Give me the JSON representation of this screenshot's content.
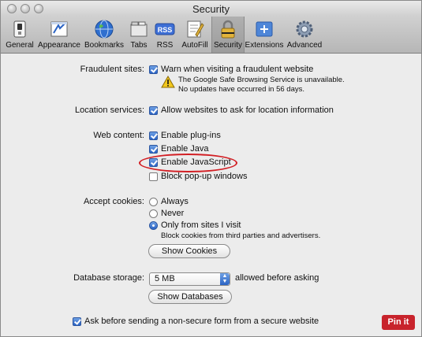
{
  "window": {
    "title": "Security"
  },
  "toolbar": {
    "items": [
      {
        "label": "General",
        "icon": "general-switch-icon"
      },
      {
        "label": "Appearance",
        "icon": "appearance-icon"
      },
      {
        "label": "Bookmarks",
        "icon": "globe-icon"
      },
      {
        "label": "Tabs",
        "icon": "tabs-icon"
      },
      {
        "label": "RSS",
        "icon": "rss-icon",
        "badge": "RSS"
      },
      {
        "label": "AutoFill",
        "icon": "autofill-icon"
      },
      {
        "label": "Security",
        "icon": "lock-icon",
        "selected": true
      },
      {
        "label": "Extensions",
        "icon": "extensions-icon"
      },
      {
        "label": "Advanced",
        "icon": "gear-icon"
      }
    ]
  },
  "fraud": {
    "label": "Fraudulent sites:",
    "checkbox_label": "Warn when visiting a fraudulent website",
    "checked": true,
    "warning_line1": "The Google Safe Browsing Service is unavailable.",
    "warning_line2": "No updates have occurred in 56 days."
  },
  "location": {
    "label": "Location services:",
    "checkbox_label": "Allow websites to ask for location information",
    "checked": true
  },
  "web": {
    "label": "Web content:",
    "options": [
      {
        "label": "Enable plug-ins",
        "checked": true
      },
      {
        "label": "Enable Java",
        "checked": true
      },
      {
        "label": "Enable JavaScript",
        "checked": true,
        "highlighted": true
      },
      {
        "label": "Block pop-up windows",
        "checked": false
      }
    ]
  },
  "cookies": {
    "label": "Accept cookies:",
    "options": [
      {
        "label": "Always",
        "selected": false
      },
      {
        "label": "Never",
        "selected": false
      },
      {
        "label": "Only from sites I visit",
        "selected": true
      }
    ],
    "note": "Block cookies from third parties and advertisers.",
    "button": "Show Cookies"
  },
  "database": {
    "label": "Database storage:",
    "value": "5 MB",
    "suffix": "allowed before asking",
    "button": "Show Databases"
  },
  "nonsecure": {
    "label": "Ask before sending a non-secure form from a secure website",
    "checked": true
  },
  "pinit": {
    "label": "Pin it"
  },
  "colors": {
    "highlight_oval": "#d21f24",
    "pin_red": "#c8232c",
    "accent_blue": "#2a63c4"
  }
}
